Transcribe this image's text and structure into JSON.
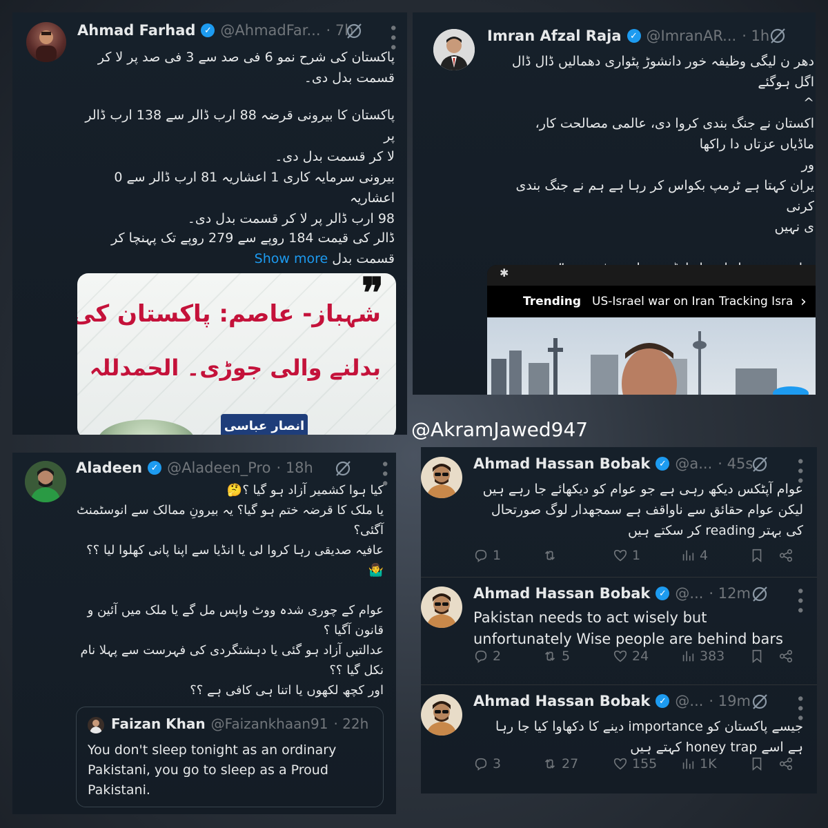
{
  "watermark": "@AkramJawed947",
  "tweet1": {
    "name": "Ahmad Farhad",
    "handle": "@AhmadFar...",
    "time": "· 7h",
    "para1": "پاکستان کی شرح نمو 6 فی صد سے 3 فی صد پر لا کر\nقسمت بدل دی۔",
    "para2": "پاکستان کا بیرونی قرضہ 88 ارب ڈالر سے 138 ارب ڈالر پر\nلا کر قسمت بدل دی۔",
    "para3": "بیرونی سرمایہ کاری 1 اعشاریہ 81 ارب ڈالر سے 0 اعشاریہ\n98 ارب ڈالر پر لا کر قسمت بدل دی۔",
    "para4a": "ڈالر کی قیمت 184 روپے سے 279 روپے تک پہنچا کر",
    "para4b": "قسمت بدل",
    "show_more": "Show more",
    "card_title1": "شہباز- عاصم: پاکستان کی قسمت",
    "card_title2": "بدلنے والی جوڑی۔ الحمدللہ",
    "card_author": "انصار عباسی"
  },
  "tweet2": {
    "name": "Imran Afzal Raja",
    "handle": "@ImranAR...",
    "time": "· 1h",
    "text": "دھر ن لیگی وظیفہ خور دانشوڑ پٹواری دھمالیں ڈال ڈال\nاگل ہوگئے\n‏^\nاکستان نے جنگ بندی کروا دی، عالمی مصالحت کار،\nماڈیاں عزتاں دا راکھا\nور\nیران کہتا ہے ٹرمپ بکواس کر رہا ہے ہم نے جنگ بندی کرنی\nی نہیں\n\nیہاں پ چ نوبل امن ایوارڈ بھی بانٹ بیٹھے ہیں”",
    "nav_items": [
      "Trending",
      "US-Israel war on Iran",
      "Tracking Isra"
    ]
  },
  "tweet3": {
    "name": "Aladeen",
    "handle": "@Aladeen_Pro",
    "time": "· 18h",
    "text": "کیا ہوا کشمیر آزاد ہو گیا ؟🤔\nیا ملک کا قرضہ ختم ہو گیا؟ یہ بیرونِ ممالک سے انوسٹمنٹ\nآگئی؟\nعافیہ صدیقی رہا کروا لی یا انڈیا سے اپنا پانی کھلوا لیا ؟؟\n🤷‍♂️\n\nعوام کے چوری شدہ ووٹ واپس مل گے یا ملک میں آئین و\nقانون آگیا ؟\nعدالتیں آزاد ہو گئی یا دہشتگردی کی فہرست سے پہلا نام\nنکل گیا ؟؟\nاور کچھ لکھوں یا اتنا ہی کافی ہے ؟؟",
    "quote": {
      "name": "Faizan Khan",
      "handle": "@Faizankhaan91",
      "time": "· 22h",
      "text": "You don't sleep tonight as an ordinary Pakistani, you go to sleep as a Proud Pakistani."
    }
  },
  "tweet4": {
    "replies": [
      {
        "name": "Ahmad Hassan Bobak",
        "handle": "@a...",
        "time": "· 45s",
        "text": "عوام آپٹکس دیکھ رہی ہے جو عوام کو دیکھائے جا رہے ہیں\nلیکن عوام حقائق سے ناواقف ہے سمجھدار لوگ صورتحال\nکی بہتر reading کر سکتے ہیں",
        "rtl": true,
        "reply_count": "1",
        "retweet_count": "",
        "like_count": "1",
        "view_count": "4"
      },
      {
        "name": "Ahmad Hassan Bobak",
        "handle": "@...",
        "time": "· 12m",
        "text": "Pakistan needs to act wisely but\nunfortunately Wise people are behind bars",
        "rtl": false,
        "reply_count": "2",
        "retweet_count": "5",
        "like_count": "24",
        "view_count": "383"
      },
      {
        "name": "Ahmad Hassan Bobak",
        "handle": "@...",
        "time": "· 19m",
        "text": "جیسے پاکستان کو importance دینے کا دکھاوا کیا جا رہا\nہے اسے honey trap کہتے ہیں",
        "rtl": true,
        "reply_count": "3",
        "retweet_count": "27",
        "like_count": "155",
        "view_count": "1K"
      }
    ]
  }
}
